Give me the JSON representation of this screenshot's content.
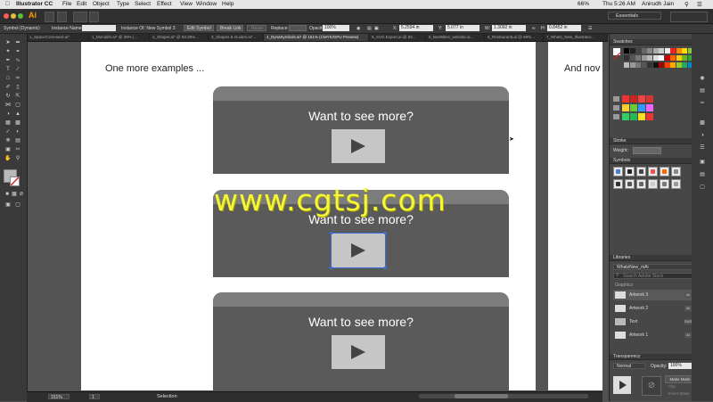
{
  "menubar": {
    "app_name": "Illustrator CC",
    "items": [
      "File",
      "Edit",
      "Object",
      "Type",
      "Select",
      "Effect",
      "View",
      "Window",
      "Help"
    ],
    "clock": "Thu 5:26 AM",
    "user": "Anirudh Jain",
    "battery": "66%"
  },
  "appbar": {
    "logo": "Ai",
    "workspace": "Essentials"
  },
  "controlbar": {
    "selection_type": "Symbol (Dynamic)",
    "instance_name_label": "Instance Name:",
    "instance_of": "Instance Of: New Symbol 3",
    "edit_symbol": "Edit Symbol",
    "break_link": "Break Link",
    "reset": "Reset",
    "replace_label": "Replace:",
    "opacity_label": "Opacity:",
    "opacity_value": "100%",
    "x_label": "X:",
    "x_value": "5.2594 in",
    "y_label": "Y:",
    "y_value": "5.077 in",
    "w_label": "W:",
    "w_value": "1.3092 in",
    "h_label": "H:",
    "h_value": "0.8452 in"
  },
  "tabs": [
    "1_SpaceCommand.ai*",
    "1_Monolith.ai* @ 39% (...",
    "2_Shaper.ai* @ 93.28%...",
    "3_Shapes & Guides.ai*...",
    "4_DynaSymbols.ai* @ 151% (CMYK/GPU Preview)",
    "5_SVG Export.ai @ 83...",
    "6_BeeBikes_website.ai...",
    "6_RestaurantLai @ 89%...",
    "7_Whats_New_Illustrator..."
  ],
  "canvas": {
    "heading_left": "One more examples ...",
    "heading_right": "And nov",
    "cards": [
      {
        "title": "Want to see more?"
      },
      {
        "title": "Want to see more?"
      },
      {
        "title": "Want to see more?"
      }
    ]
  },
  "statusbar": {
    "zoom": "151%",
    "artboard_number": "1",
    "tool_name": "Selection"
  },
  "panels": {
    "swatches": {
      "title": "Swatches"
    },
    "stroke": {
      "title": "Stroke",
      "weight_label": "Weight:"
    },
    "symbols": {
      "title": "Symbols"
    },
    "libraries": {
      "title": "Libraries",
      "library_name": "WhatsNew_mAi",
      "search_placeholder": "Search Adobe Stock",
      "section": "Graphics",
      "items": [
        {
          "label": "Artwork 3",
          "badge": "Ai"
        },
        {
          "label": "Artwork 2",
          "badge": "Ai"
        },
        {
          "label": "Text",
          "badge": "SVG"
        },
        {
          "label": "Artwork 1",
          "badge": "Ai"
        }
      ]
    },
    "transparency": {
      "title": "Transparency",
      "mode": "Normal",
      "opacity_label": "Opacity:",
      "opacity_value": "100%",
      "make_mask": "Make Mask",
      "clip": "Clip",
      "invert_mask": "Invert Mask"
    }
  },
  "watermark": "www.cgtsj.com",
  "colors": {
    "selection_blue": "#3a6fd8",
    "watermark": "#f7f73a",
    "card_body": "#5a5a5a",
    "card_top": "#7c7c7c"
  }
}
